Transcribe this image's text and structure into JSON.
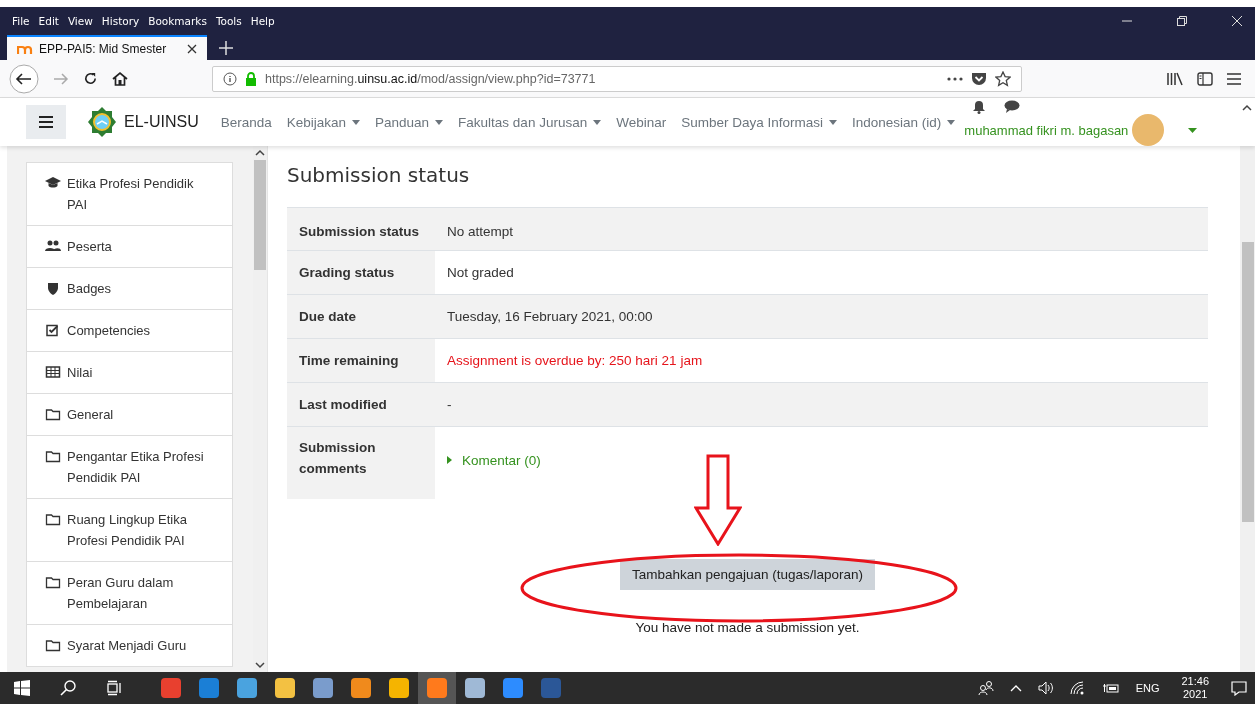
{
  "browser": {
    "menu": [
      "File",
      "Edit",
      "View",
      "History",
      "Bookmarks",
      "Tools",
      "Help"
    ],
    "tab": {
      "title": "EPP-PAI5: Mid Smester"
    },
    "url": {
      "host_before": "https://elearning.",
      "host": "uinsu.ac.id",
      "path": "/mod/assign/view.php?id=73771"
    }
  },
  "navbar": {
    "brand": "EL-UINSU",
    "items": [
      {
        "label": "Beranda",
        "dropdown": false
      },
      {
        "label": "Kebijakan",
        "dropdown": true
      },
      {
        "label": "Panduan",
        "dropdown": true
      },
      {
        "label": "Fakultas dan Jurusan",
        "dropdown": true
      },
      {
        "label": "Webinar",
        "dropdown": false
      },
      {
        "label": "Sumber Daya Informasi",
        "dropdown": true
      },
      {
        "label": "Indonesian (id)",
        "dropdown": true
      }
    ],
    "user": "muhammad fikri m. bagasan"
  },
  "sidebar": {
    "items": [
      {
        "kind": "course",
        "label": "Etika Profesi Pendidik PAI"
      },
      {
        "kind": "participants",
        "label": "Peserta"
      },
      {
        "kind": "badges",
        "label": "Badges"
      },
      {
        "kind": "competencies",
        "label": "Competencies"
      },
      {
        "kind": "grades",
        "label": "Nilai"
      },
      {
        "kind": "section",
        "label": "General"
      },
      {
        "kind": "section",
        "label": "Pengantar Etika Profesi Pendidik PAI"
      },
      {
        "kind": "section",
        "label": "Ruang Lingkup Etika Profesi Pendidik PAI"
      },
      {
        "kind": "section",
        "label": "Peran Guru dalam Pembelajaran"
      },
      {
        "kind": "section",
        "label": "Syarat Menjadi Guru"
      }
    ]
  },
  "main": {
    "title": "Submission status",
    "rows": [
      {
        "kind": "text",
        "label": "Submission status",
        "value": "No attempt"
      },
      {
        "kind": "text",
        "label": "Grading status",
        "value": "Not graded"
      },
      {
        "kind": "text",
        "label": "Due date",
        "value": "Tuesday, 16 February 2021, 00:00"
      },
      {
        "kind": "overdue",
        "label": "Time remaining",
        "value": "Assignment is overdue by: 250 hari 21 jam"
      },
      {
        "kind": "text",
        "label": "Last modified",
        "value": "-"
      },
      {
        "kind": "comments",
        "label": "Submission comments",
        "value": "Komentar (0)",
        "expanded": false
      }
    ],
    "button": "Tambahkan pengajuan (tugas/laporan)",
    "note": "You have not made a submission yet."
  },
  "taskbar": {
    "apps": [
      {
        "kind": "record",
        "selected": false
      },
      {
        "kind": "edge",
        "selected": false
      },
      {
        "kind": "panel",
        "selected": false
      },
      {
        "kind": "folder",
        "selected": false
      },
      {
        "kind": "network",
        "selected": false
      },
      {
        "kind": "vlc",
        "selected": false
      },
      {
        "kind": "aimp",
        "selected": false
      },
      {
        "kind": "firefox",
        "selected": true
      },
      {
        "kind": "scanner",
        "selected": false
      },
      {
        "kind": "zoom",
        "selected": false
      },
      {
        "kind": "word",
        "selected": false
      }
    ],
    "lang": "ENG",
    "time": "21:46",
    "date": "2021"
  }
}
